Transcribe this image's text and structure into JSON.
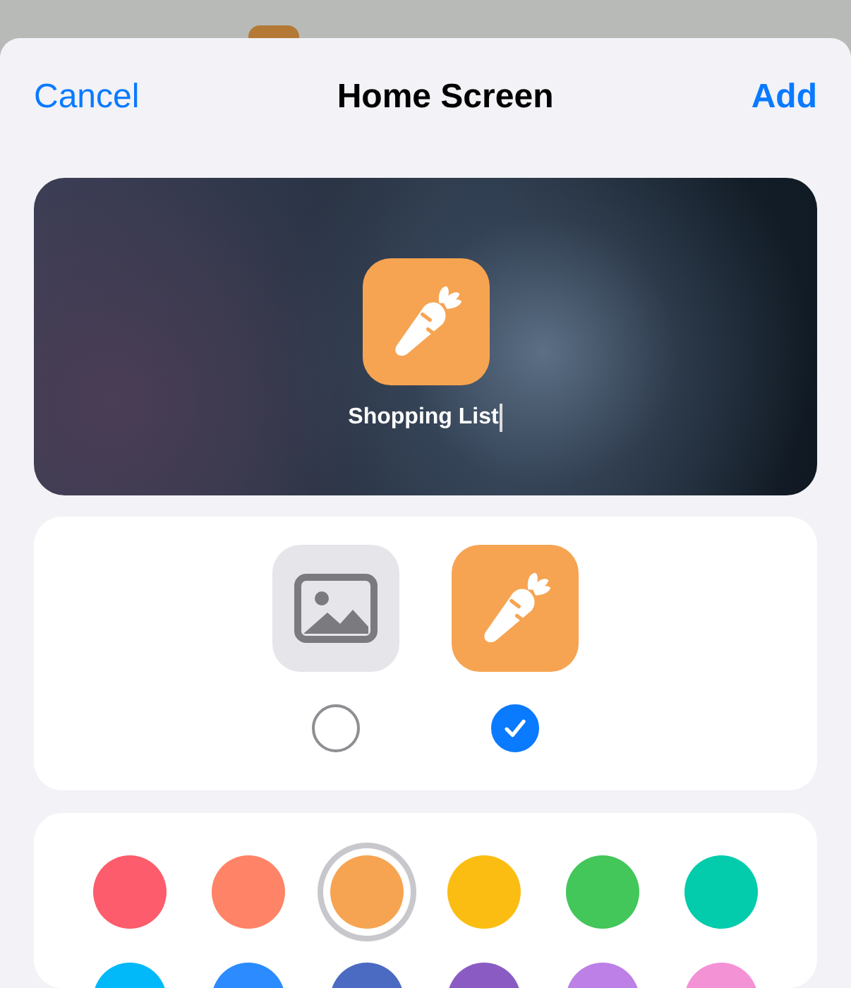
{
  "nav": {
    "cancel": "Cancel",
    "title": "Home Screen",
    "add": "Add"
  },
  "preview": {
    "name": "Shopping List"
  },
  "icon_styles": [
    {
      "kind": "photo",
      "selected": false
    },
    {
      "kind": "glyph",
      "selected": true
    }
  ],
  "colors": [
    {
      "color": "#fc5c6c",
      "selected": false
    },
    {
      "color": "#ff8366",
      "selected": false
    },
    {
      "color": "#f6a452",
      "selected": true
    },
    {
      "color": "#fbbd12",
      "selected": false
    },
    {
      "color": "#43c65a",
      "selected": false
    },
    {
      "color": "#02ccac",
      "selected": false
    },
    {
      "color": "#01b9f8",
      "selected": false
    },
    {
      "color": "#2b8bff",
      "selected": false
    },
    {
      "color": "#4b6ac1",
      "selected": false
    },
    {
      "color": "#8a5cc3",
      "selected": false
    },
    {
      "color": "#bc80e6",
      "selected": false
    },
    {
      "color": "#f492d6",
      "selected": false
    }
  ]
}
